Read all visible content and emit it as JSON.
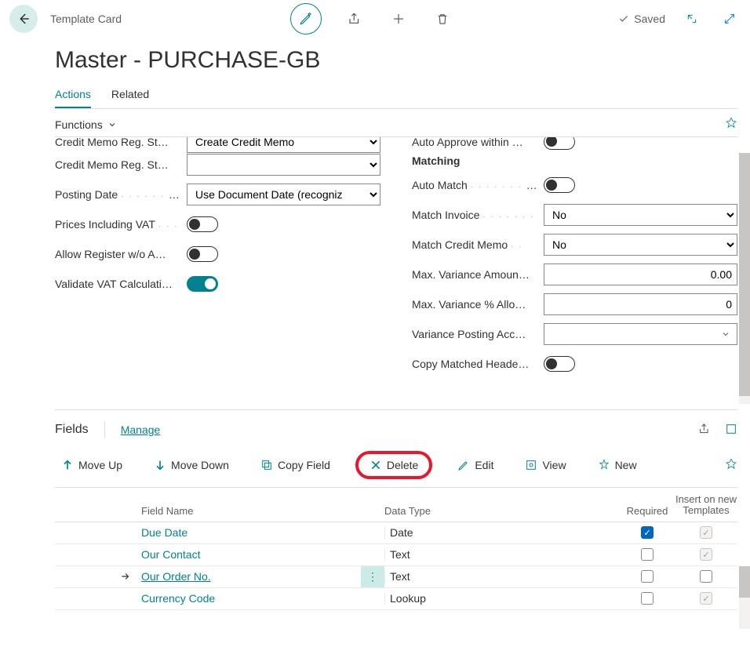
{
  "breadcrumb": "Template Card",
  "saved_label": "Saved",
  "page_title": "Master - PURCHASE-GB",
  "tabs": {
    "actions": "Actions",
    "related": "Related"
  },
  "functions_label": "Functions",
  "left_col": {
    "credit_memo_top_label": "Credit Memo Reg. St…",
    "credit_memo_top_value": "Create Credit Memo",
    "credit_memo_label": "Credit Memo Reg. St…",
    "posting_date_label": "Posting Date",
    "posting_date_value": "Use Document Date (recogniz",
    "prices_vat_label": "Prices Including VAT",
    "allow_register_label": "Allow Register w/o A…",
    "validate_vat_label": "Validate VAT Calculati…"
  },
  "right_col": {
    "auto_approve_label": "Auto Approve within …",
    "matching_heading": "Matching",
    "auto_match_label": "Auto Match",
    "match_invoice_label": "Match Invoice",
    "match_invoice_value": "No",
    "match_credit_label": "Match Credit Memo",
    "match_credit_value": "No",
    "max_var_amount_label": "Max. Variance Amoun…",
    "max_var_amount_value": "0.00",
    "max_var_pct_label": "Max. Variance % Allo…",
    "max_var_pct_value": "0",
    "var_posting_label": "Variance Posting Acc…",
    "copy_matched_label": "Copy Matched Heade…"
  },
  "fields": {
    "title": "Fields",
    "manage": "Manage",
    "actions": {
      "moveup": "Move Up",
      "movedown": "Move Down",
      "copyfield": "Copy Field",
      "delete": "Delete",
      "edit": "Edit",
      "view": "View",
      "new": "New"
    },
    "columns": {
      "name": "Field Name",
      "type": "Data Type",
      "required": "Required",
      "insert": "Insert on new Templates"
    },
    "rows": [
      {
        "name": "Due Date",
        "type": "Date",
        "required": true,
        "insert_gray": true,
        "selected": false
      },
      {
        "name": "Our Contact",
        "type": "Text",
        "required": false,
        "insert_gray": true,
        "selected": false
      },
      {
        "name": "Our Order No.",
        "type": "Text",
        "required": false,
        "insert_gray": false,
        "selected": true
      },
      {
        "name": "Currency Code",
        "type": "Lookup",
        "required": false,
        "insert_gray": true,
        "selected": false
      }
    ]
  }
}
